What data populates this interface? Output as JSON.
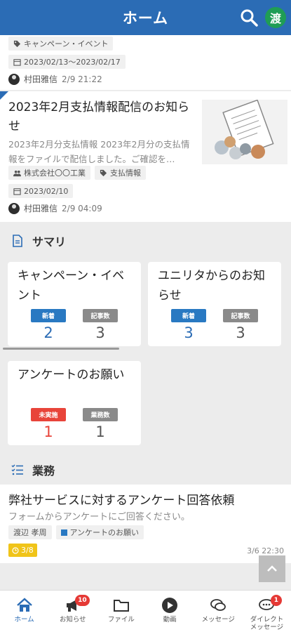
{
  "header": {
    "title": "ホーム",
    "avatar_initial": "渡"
  },
  "top_article": {
    "tag_category": "キャンペーン・イベント",
    "date_range": "2023/02/13〜2023/02/17",
    "author": "村田雅信",
    "time": "2/9 21:22"
  },
  "article": {
    "title": "2023年2月支払情報配信のお知らせ",
    "description": "2023年2月分支払情報 2023年2月分の支払情報をファイルで配信しました。ご確認を…",
    "tag_company": "株式会社〇〇工業",
    "tag_category": "支払情報",
    "date": "2023/02/10",
    "author": "村田雅信",
    "time": "2/9 04:09"
  },
  "summary": {
    "heading": "サマリ",
    "cards": [
      {
        "title": "キャンペーン・イベント",
        "badge1": "新着",
        "badge2": "記事数",
        "value1": "2",
        "value2": "3"
      },
      {
        "title": "ユニリタからのお知らせ",
        "badge1": "新着",
        "badge2": "記事数",
        "value1": "3",
        "value2": "3"
      },
      {
        "title": "アンケートのお願い",
        "badge1": "未実施",
        "badge2": "業務数",
        "value1": "1",
        "value2": "1"
      }
    ]
  },
  "business": {
    "heading": "業務",
    "title": "弊社サービスに対するアンケート回答依頼",
    "description": "フォームからアンケートにご回答ください。",
    "person": "渡辺 孝周",
    "category": "アンケートのお願い",
    "deadline": "3/8",
    "time": "3/6 22:30"
  },
  "nav": {
    "items": [
      {
        "label": "ホーム",
        "badge": ""
      },
      {
        "label": "お知らせ",
        "badge": "10"
      },
      {
        "label": "ファイル",
        "badge": ""
      },
      {
        "label": "動画",
        "badge": ""
      },
      {
        "label": "メッセージ",
        "badge": ""
      },
      {
        "label": "ダイレクト\nメッセージ",
        "badge": "1"
      }
    ]
  },
  "colors": {
    "primary": "#2b6cb5",
    "badge_red": "#e53935",
    "deadline": "#f0c419"
  }
}
